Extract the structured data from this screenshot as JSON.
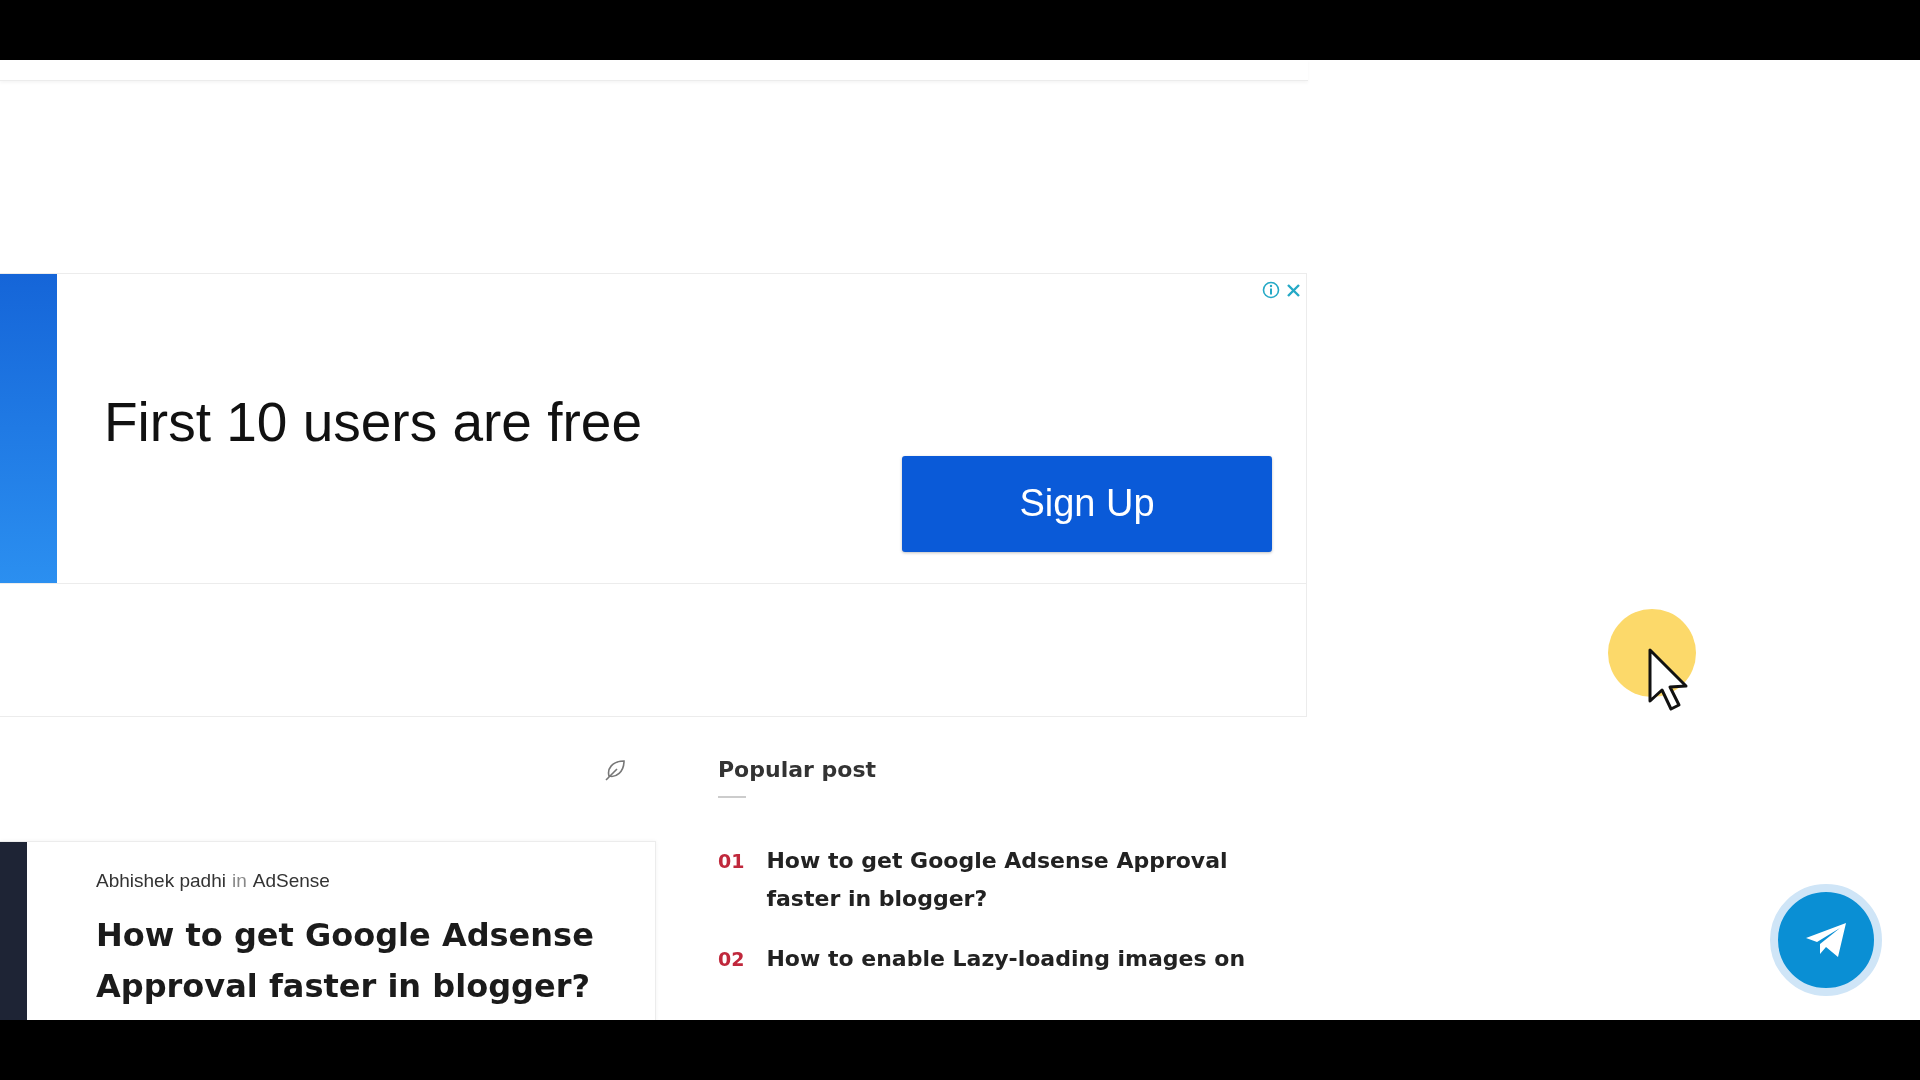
{
  "ad": {
    "headline": "First 10 users are free",
    "button": "Sign Up"
  },
  "post_card": {
    "author": "Abhishek padhi",
    "connector": "in",
    "category": "AdSense",
    "title": "How to get Google Adsense Approval faster in blogger?"
  },
  "popular": {
    "heading": "Popular post",
    "items": [
      {
        "number": "01",
        "title": "How to get Google Adsense Approval faster in blogger?"
      },
      {
        "number": "02",
        "title": "How to enable Lazy-loading images on"
      }
    ]
  }
}
